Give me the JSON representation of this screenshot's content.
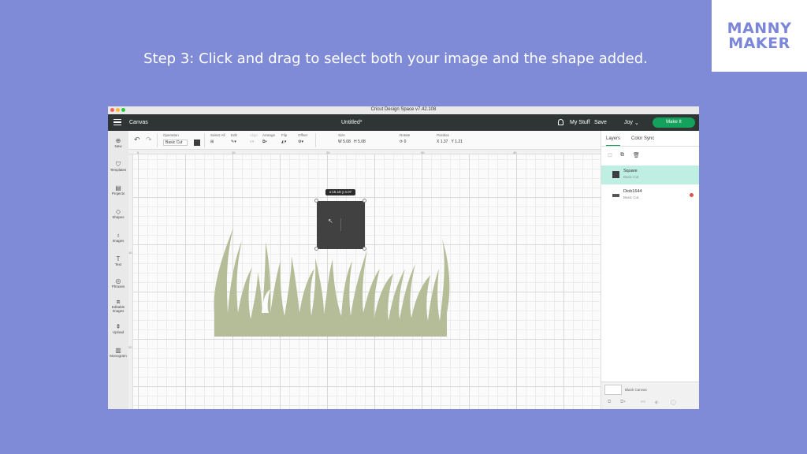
{
  "logo": {
    "line1": "MANNY",
    "line2": "MAKER"
  },
  "caption": "Step 3: Click and drag to select both your image and the shape added.",
  "window": {
    "title": "Cricut Design Space  v7.42.108",
    "traffic_lights": [
      "#ff5f57",
      "#febc2e",
      "#28c840"
    ]
  },
  "appbar": {
    "canvas_label": "Canvas",
    "doc_title": "Untitled*",
    "my_stuff": "My Stuff",
    "save": "Save",
    "user": "Joy",
    "make_it": "Make It"
  },
  "toolbar": {
    "operation_label": "Operation",
    "operation_value": "Basic Cut",
    "select_all": "Select All",
    "edit": "Edit",
    "align": "Align",
    "arrange": "Arrange",
    "flip": "Flip",
    "offset": "Offset",
    "size": "Size",
    "w_label": "W",
    "w_value": "5.08",
    "h_label": "H",
    "h_value": "5.08",
    "rotate": "Rotate",
    "rotate_value": "0",
    "position": "Position",
    "x_label": "X",
    "x_value": "1.37",
    "y_label": "Y",
    "y_value": "1.21"
  },
  "leftbar": [
    "New",
    "Templates",
    "Projects",
    "Shapes",
    "Images",
    "Text",
    "Phrases",
    "Editable Images",
    "Upload",
    "Monogram"
  ],
  "rulers": {
    "top": [
      "0",
      "10",
      "20",
      "30",
      "40"
    ],
    "left": [
      "10",
      "20"
    ]
  },
  "canvas": {
    "coord_tooltip": "x:16.18  y:4.07"
  },
  "layers_panel": {
    "tab_layers": "Layers",
    "tab_color_sync": "Color Sync",
    "layers": [
      {
        "name": "Square",
        "sub": "Basic Cut",
        "color": "#3d3d3d"
      },
      {
        "name": "Diob1644",
        "sub": "Basic Cut",
        "color": "#555555"
      }
    ],
    "blank_canvas": "Blank Canvas"
  },
  "colors": {
    "background": "#7f8bd6",
    "grass": "#b5bd98",
    "accent": "#14a15c",
    "selected_layer": "#bfeee2"
  }
}
